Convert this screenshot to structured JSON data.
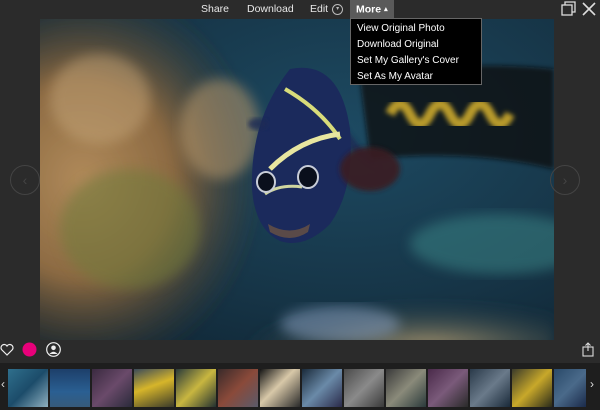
{
  "toolbar": {
    "share": "Share",
    "download": "Download",
    "edit": "Edit",
    "more": "More"
  },
  "more_menu": {
    "items": [
      "View Original Photo",
      "Download Original",
      "Set My Gallery's Cover",
      "Set As My Avatar"
    ]
  },
  "window_controls": {
    "restore_icon": "restore-icon",
    "close_icon": "close-icon"
  },
  "viewer": {
    "prev_icon": "chevron-left-icon",
    "next_icon": "chevron-right-icon",
    "prev_glyph": "‹",
    "next_glyph": "›"
  },
  "actions": {
    "like_icon": "heart-icon",
    "color_icon": "pink-dot-icon",
    "avatar_icon": "user-icon",
    "share_icon": "share-icon",
    "accent": "#e8007a"
  },
  "filmstrip": {
    "prev_glyph": "‹",
    "next_glyph": "›",
    "thumbnail_count": 14
  }
}
